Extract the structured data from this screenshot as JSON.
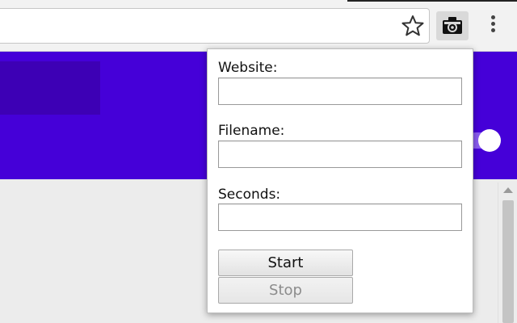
{
  "browser": {
    "address_value": "",
    "star_icon": "star-outline-icon",
    "extension_icon": "camera-icon",
    "menu_icon": "kebab-menu-icon"
  },
  "page": {
    "header_color": "#4500d8",
    "body_color": "#ececec"
  },
  "popup": {
    "fields": [
      {
        "label": "Website:",
        "value": ""
      },
      {
        "label": "Filename:",
        "value": ""
      },
      {
        "label": "Seconds:",
        "value": ""
      }
    ],
    "start_label": "Start",
    "stop_label": "Stop"
  }
}
